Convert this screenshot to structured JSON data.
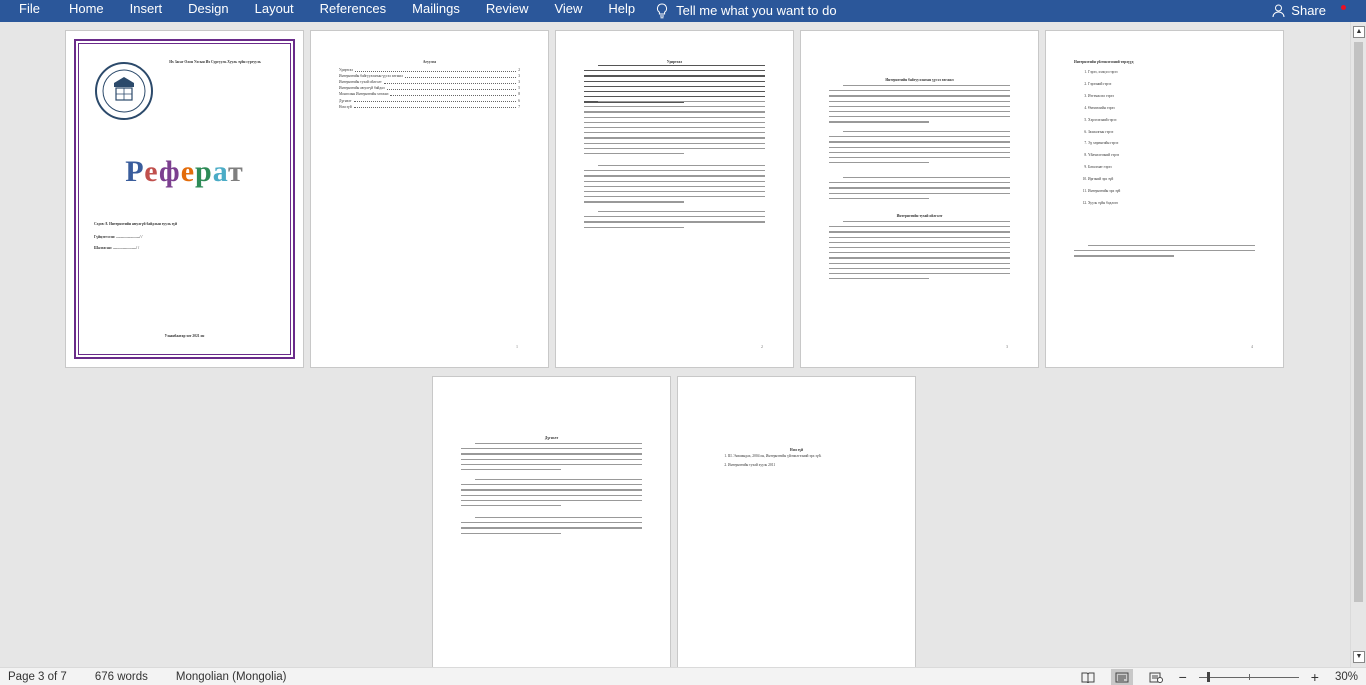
{
  "ribbon": {
    "tabs": [
      "File",
      "Home",
      "Insert",
      "Design",
      "Layout",
      "References",
      "Mailings",
      "Review",
      "View",
      "Help"
    ],
    "tell_me": "Tell me what you want to do",
    "share": "Share"
  },
  "pages": {
    "cover": {
      "university": "Их Засаг Олон Улсын Их Сургууль Хууль зүйн сургууль",
      "title_letters": [
        "Р",
        "е",
        "ф",
        "е",
        "р",
        "а",
        "т"
      ],
      "title_colors": [
        "#3a5d9c",
        "#c0504d",
        "#7b3f8f",
        "#e36c0a",
        "#2e8b57",
        "#4bacc6",
        "#7f7f7f"
      ],
      "subject": "Сэдэв: 8. Интернэтийн аюулгүй байдлын хууль зүй",
      "checker": "Гүйцэтгэсэн: ........................../ /",
      "reviewer": "Шалгасан: ........................../ /",
      "footer": "Улаанбаатар хот 2021 он"
    },
    "toc": {
      "heading": "Агуулга",
      "items": [
        {
          "label": "Удиртгал",
          "page": "2"
        },
        {
          "label": "Интернэтийн байгууллагын үүсэл хөгжил",
          "page": "3"
        },
        {
          "label": "Интернэтийн тухай ойлголт",
          "page": "3"
        },
        {
          "label": "Интернэтийн аюулгүй байдал",
          "page": "5"
        },
        {
          "label": "Монголын Интернэтийн хөгжил",
          "page": "8"
        },
        {
          "label": "Дүгнэлт",
          "page": "6"
        },
        {
          "label": "Ном зүй",
          "page": "7"
        }
      ],
      "number": "1"
    },
    "intro": {
      "heading": "Удиртгал",
      "number": "2"
    },
    "history": {
      "heading": "Интернэтийн байгууллагын үүсэл хөгжил",
      "heading2": "Интернэтийн тухай ойлголт",
      "number": "3"
    },
    "list": {
      "heading": "Интернэтийн үйлчилгээний төрлүүд",
      "items": [
        "Гэрээ, хэлцэл гэрээ",
        "Гэрээний гэрээ",
        "Итгэмжлэл гэрээ",
        "Өмчлөлийн гэрээ",
        "Хэрэглээний гэрээ",
        "Захиалгын гэрээ",
        "Эд хөрөнгийн гэрээ",
        "Үйлчилгээний гэрээ",
        "Баталгаат гэрээ",
        "Иргэний эрх зүй",
        "Интернэтийн эрх зүй",
        "Хууль зүйн бодлого"
      ],
      "number": "4"
    },
    "conclusion": {
      "heading": "Дүгнэлт"
    },
    "biblio": {
      "heading": "Ном зүй",
      "items": [
        "Ш. Энхмандах, 2004 он, Интернэтийн үйлчилгээний эрх зүй.",
        "Интернэтийн тухай хууль 2011"
      ]
    }
  },
  "status": {
    "page": "Page 3 of 7",
    "words": "676 words",
    "language": "Mongolian (Mongolia)",
    "zoom": "30%"
  }
}
